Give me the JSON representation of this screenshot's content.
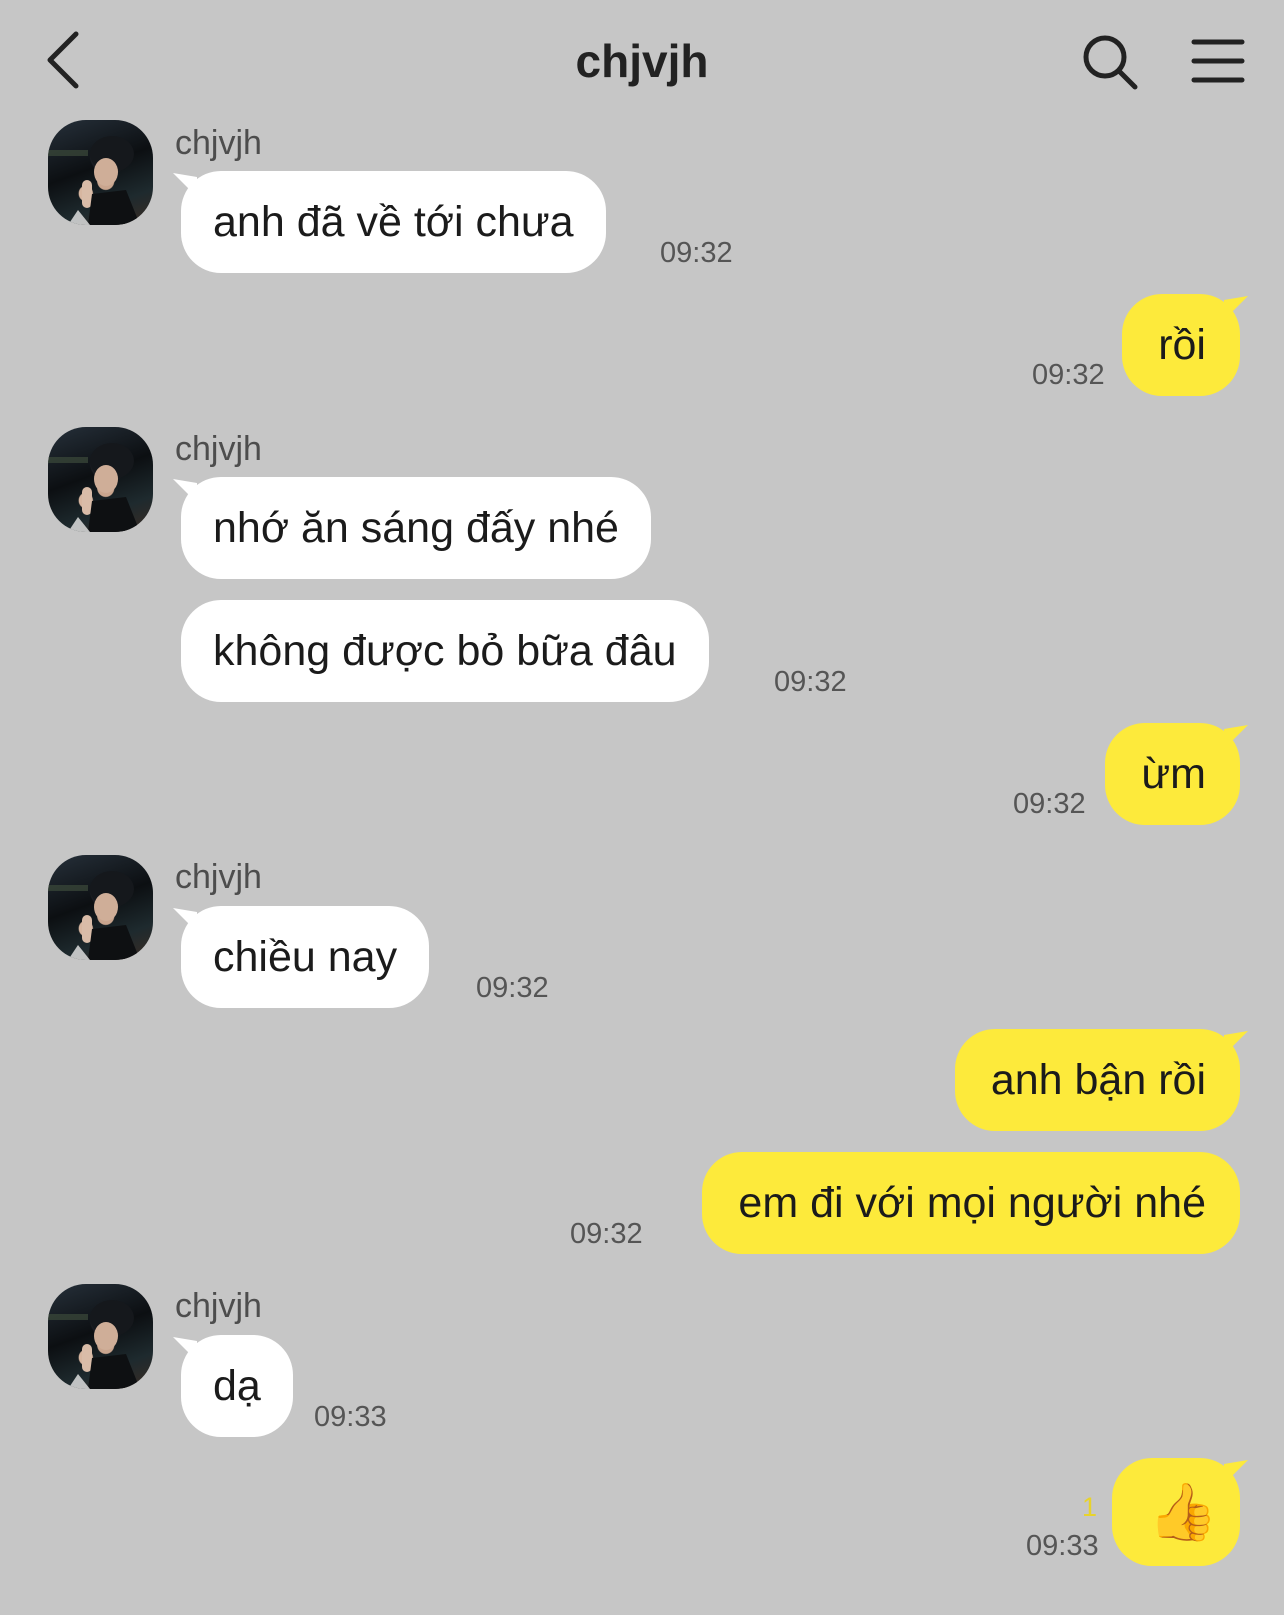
{
  "header": {
    "title": "chjvjh",
    "back_icon": "chevron-left-icon",
    "search_icon": "search-icon",
    "menu_icon": "hamburger-menu-icon"
  },
  "colors": {
    "background": "#c6c6c6",
    "incoming_bubble": "#ffffff",
    "outgoing_bubble": "#fdea3b",
    "unread_count": "#e8d32b"
  },
  "messages": [
    {
      "direction": "in",
      "sender": "chjvjh",
      "text": "anh đã về tới chưa",
      "time": "09:32"
    },
    {
      "direction": "out",
      "text": "rồi",
      "time": "09:32"
    },
    {
      "direction": "in",
      "sender": "chjvjh",
      "text": "nhớ ăn sáng đấy nhé",
      "time": ""
    },
    {
      "direction": "in",
      "text": "không được bỏ bữa đâu",
      "time": "09:32"
    },
    {
      "direction": "out",
      "text": "ừm",
      "time": "09:32"
    },
    {
      "direction": "in",
      "sender": "chjvjh",
      "text": "chiều nay",
      "time": "09:32"
    },
    {
      "direction": "out",
      "text": "anh bận rồi",
      "time": ""
    },
    {
      "direction": "out",
      "text": "em đi với mọi người nhé",
      "time": "09:32"
    },
    {
      "direction": "in",
      "sender": "chjvjh",
      "text": "dạ",
      "time": "09:33"
    },
    {
      "direction": "out",
      "text": "👍",
      "time": "09:33",
      "unread": "1"
    }
  ]
}
